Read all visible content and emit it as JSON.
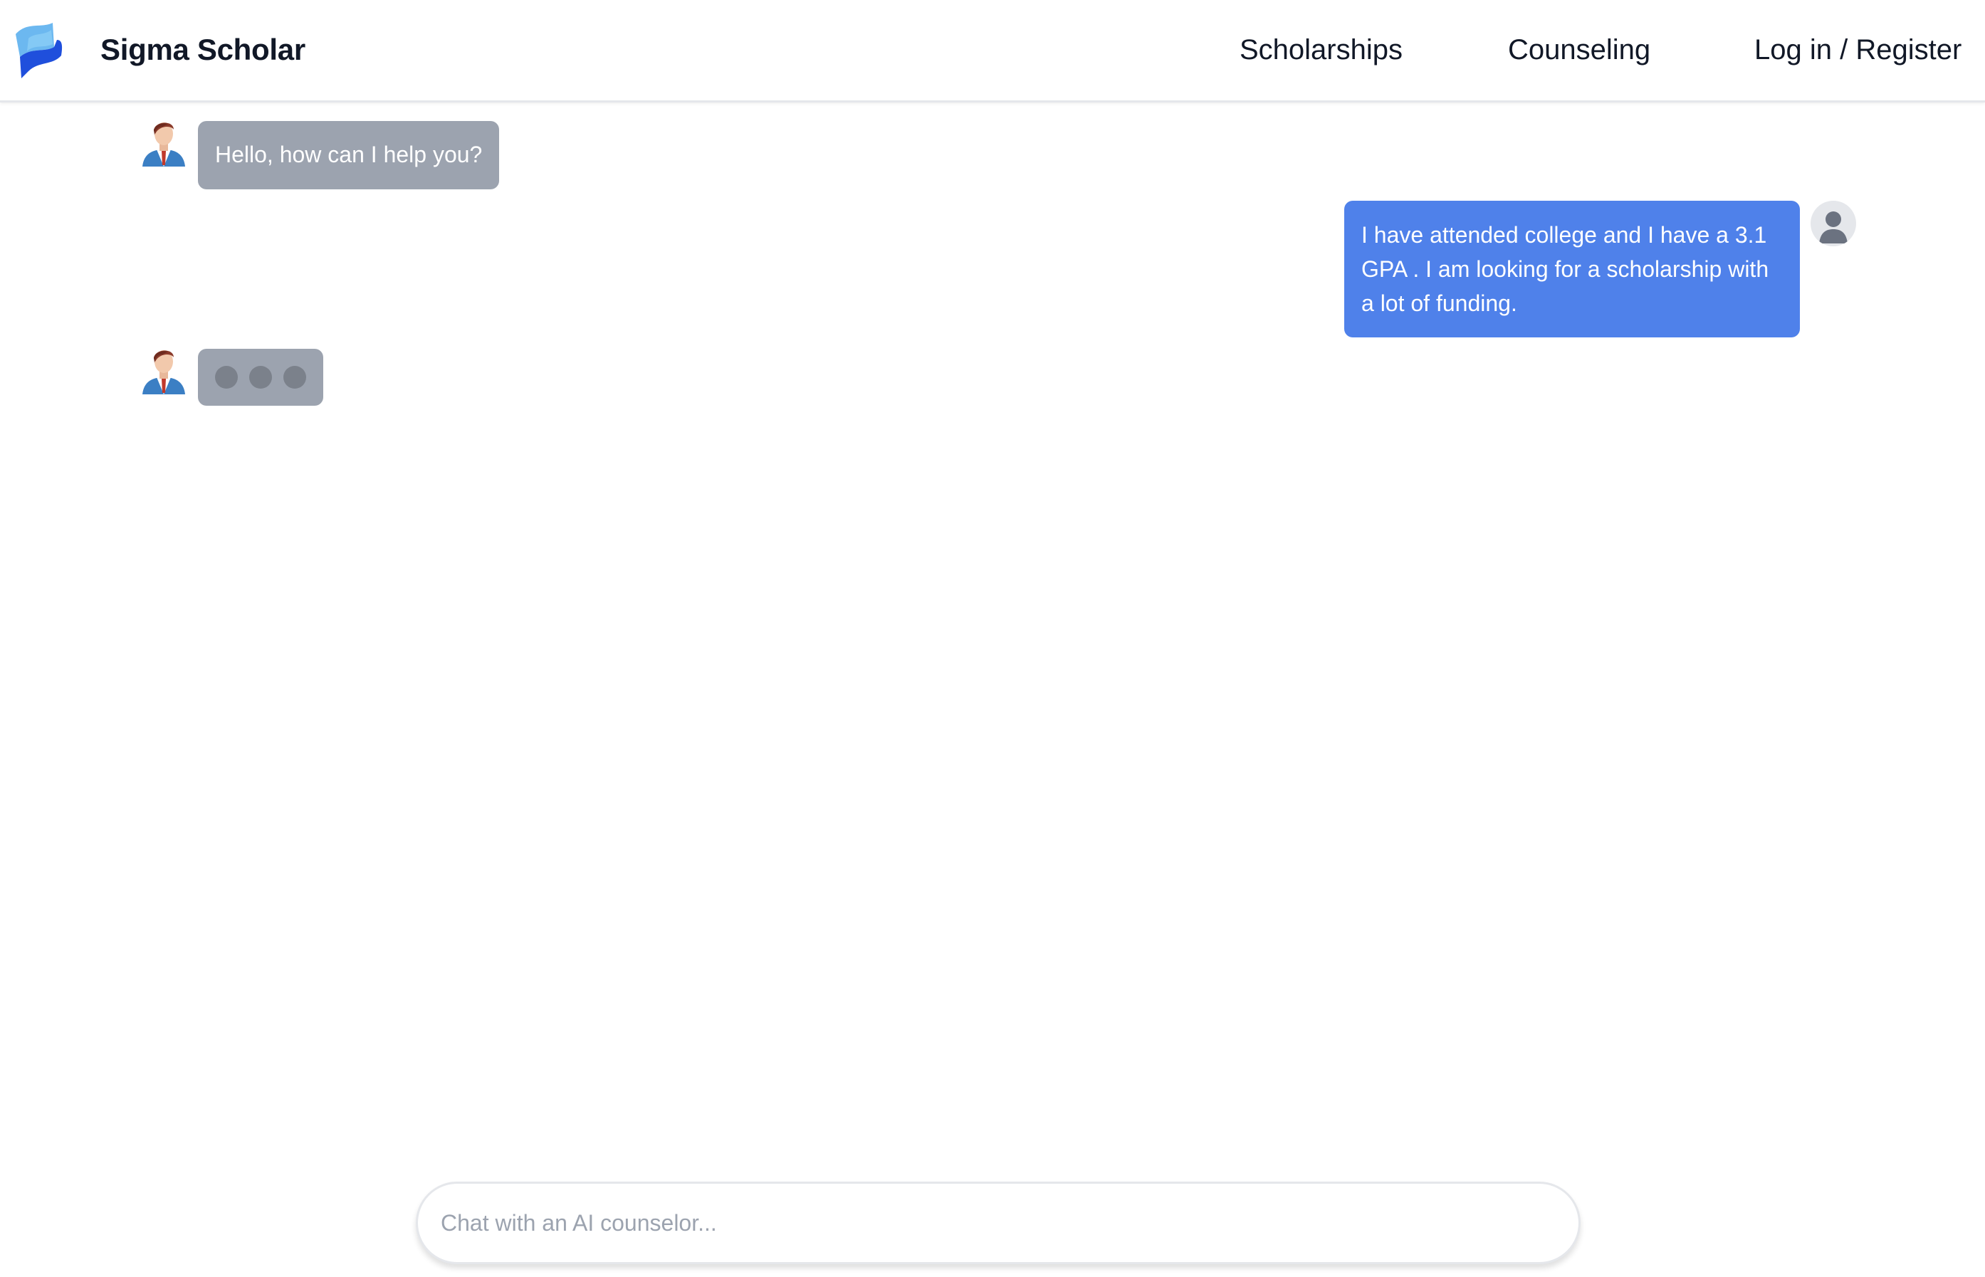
{
  "brand": {
    "name": "Sigma Scholar",
    "logo_icon": "feather-flag-logo"
  },
  "nav": {
    "items": [
      {
        "label": "Scholarships"
      },
      {
        "label": "Counseling"
      },
      {
        "label": "Log in / Register"
      }
    ]
  },
  "chat": {
    "messages": [
      {
        "sender": "bot",
        "avatar_icon": "counselor-avatar-icon",
        "text": "Hello, how can I help you?"
      },
      {
        "sender": "user",
        "avatar_icon": "user-avatar-icon",
        "text": "I have attended college and I have a 3.1 GPA . I am looking for a scholarship with a lot of funding."
      },
      {
        "sender": "bot",
        "avatar_icon": "counselor-avatar-icon",
        "typing": true
      }
    ],
    "input": {
      "value": "",
      "placeholder": "Chat with an AI counselor..."
    }
  },
  "colors": {
    "bot_bubble": "#9ca3af",
    "user_bubble": "#4f81ea",
    "typing_dot": "#7b818b",
    "brand_text": "#111827",
    "logo_light": "#6cb8f0",
    "logo_dark": "#1f4fdc"
  }
}
